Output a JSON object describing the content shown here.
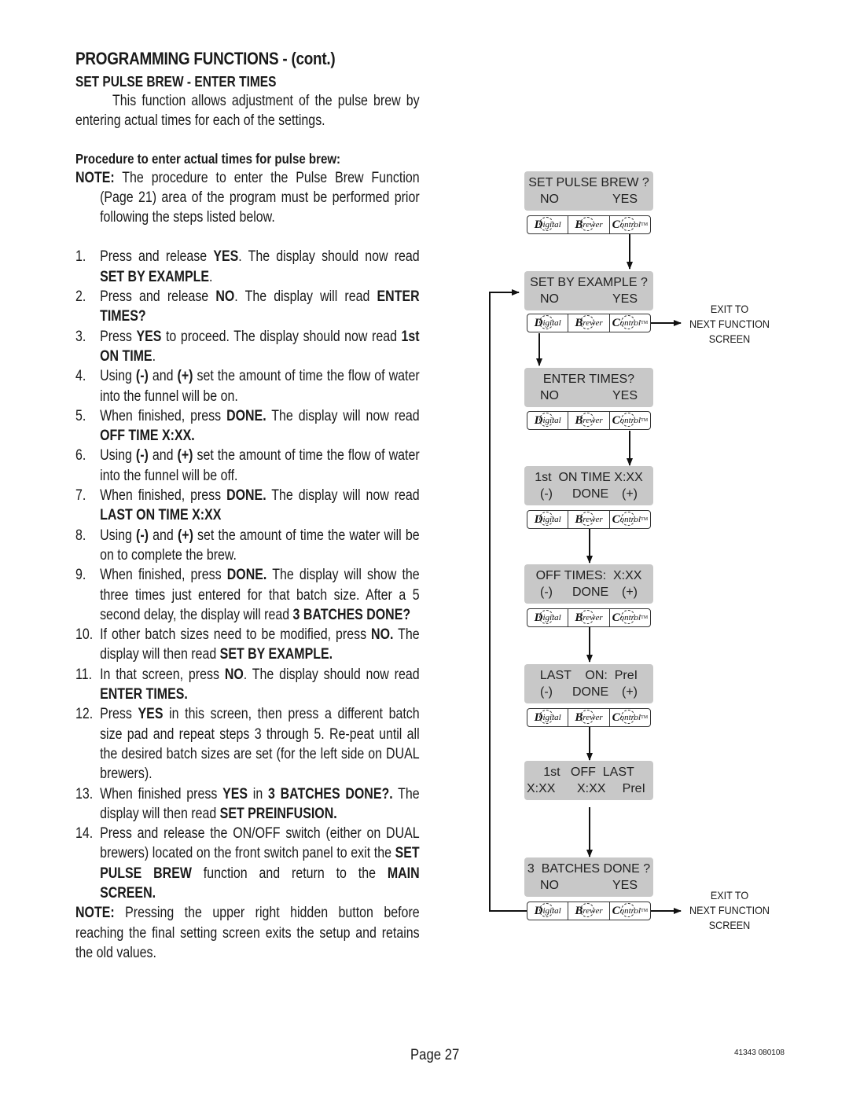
{
  "page": {
    "title": "PROGRAMMING FUNCTIONS - (cont.)",
    "section_title": "SET PULSE BREW - ENTER TIMES",
    "intro": "This function allows adjustment of the pulse brew by entering actual times for each of the settings.",
    "procedure_title": "Procedure to enter actual times for pulse brew:",
    "note1_label": "NOTE:",
    "note1_text": " The procedure to enter the Pulse Brew Function (Page 21) area of the program must be performed prior following the steps listed below.",
    "steps": [
      {
        "num": "1.",
        "parts": [
          [
            "t",
            "Press and release "
          ],
          [
            "b",
            "YES"
          ],
          [
            "t",
            ". The display should now read "
          ],
          [
            "b",
            "SET BY EXAMPLE"
          ],
          [
            "t",
            "."
          ]
        ]
      },
      {
        "num": "2.",
        "parts": [
          [
            "t",
            "Press and release "
          ],
          [
            "b",
            "NO"
          ],
          [
            "t",
            ". The display will read "
          ],
          [
            "b",
            "ENTER TIMES?"
          ]
        ]
      },
      {
        "num": "3.",
        "parts": [
          [
            "t",
            "Press "
          ],
          [
            "b",
            "YES"
          ],
          [
            "t",
            " to proceed. The display should now read "
          ],
          [
            "b",
            "1st ON TIME"
          ],
          [
            "t",
            "."
          ]
        ]
      },
      {
        "num": "4.",
        "parts": [
          [
            "t",
            "Using "
          ],
          [
            "b",
            "(-)"
          ],
          [
            "t",
            " and "
          ],
          [
            "b",
            "(+)"
          ],
          [
            "t",
            " set the amount of time the flow of water into the funnel will be on."
          ]
        ]
      },
      {
        "num": "5.",
        "parts": [
          [
            "t",
            "When finished, press "
          ],
          [
            "b",
            "DONE."
          ],
          [
            "t",
            " The display will now read "
          ],
          [
            "b",
            "OFF TIME X:XX."
          ]
        ]
      },
      {
        "num": "6.",
        "parts": [
          [
            "t",
            "Using "
          ],
          [
            "b",
            "(-)"
          ],
          [
            "t",
            " and "
          ],
          [
            "b",
            "(+)"
          ],
          [
            "t",
            " set the amount of time the flow of water into the funnel will be off."
          ]
        ]
      },
      {
        "num": "7.",
        "parts": [
          [
            "t",
            "When finished, press "
          ],
          [
            "b",
            "DONE."
          ],
          [
            "t",
            " The display will now read "
          ],
          [
            "b",
            "LAST ON TIME X:XX"
          ]
        ]
      },
      {
        "num": "8.",
        "parts": [
          [
            "t",
            "Using "
          ],
          [
            "b",
            "(-)"
          ],
          [
            "t",
            " and "
          ],
          [
            "b",
            "(+)"
          ],
          [
            "t",
            " set the amount of time the water will be on to complete the brew."
          ]
        ]
      },
      {
        "num": "9.",
        "parts": [
          [
            "t",
            "When finished, press "
          ],
          [
            "b",
            "DONE."
          ],
          [
            "t",
            " The display will show the three times just entered for that batch size. After a 5 second delay, the display will read "
          ],
          [
            "b",
            "3 BATCHES DONE?"
          ]
        ]
      },
      {
        "num": "10.",
        "parts": [
          [
            "t",
            "If other batch sizes need to be modified, press "
          ],
          [
            "b",
            "NO."
          ],
          [
            "t",
            " The display will then read "
          ],
          [
            "b",
            "SET BY EXAMPLE."
          ]
        ]
      },
      {
        "num": "11.",
        "parts": [
          [
            "t",
            "In that screen, press "
          ],
          [
            "b",
            "NO"
          ],
          [
            "t",
            ". The display should now read "
          ],
          [
            "b",
            "ENTER TIMES."
          ]
        ]
      },
      {
        "num": "12.",
        "parts": [
          [
            "t",
            "Press "
          ],
          [
            "b",
            "YES"
          ],
          [
            "t",
            " in this screen, then press a different batch size pad and repeat steps 3 through 5.  Re-peat until all the desired batch sizes are set (for the left side on DUAL brewers)."
          ]
        ]
      },
      {
        "num": "13.",
        "parts": [
          [
            "t",
            "When finished press "
          ],
          [
            "b",
            "YES"
          ],
          [
            "t",
            " in "
          ],
          [
            "b",
            "3 BATCHES DONE?."
          ],
          [
            "t",
            " The display will then read "
          ],
          [
            "b",
            "SET PREINFUSION."
          ]
        ]
      },
      {
        "num": "14.",
        "parts": [
          [
            "t",
            "Press and release the ON/OFF switch (either on DUAL brewers) located on the front switch panel to exit the "
          ],
          [
            "b",
            "SET PULSE BREW"
          ],
          [
            "t",
            " function and return to the "
          ],
          [
            "b",
            "MAIN SCREEN."
          ]
        ]
      }
    ],
    "note2_label": "NOTE:",
    "note2_text": " Pressing the upper right hidden button before reaching the final setting screen exits the setup and retains the old values.",
    "footer": {
      "page_label": "Page 27",
      "doc_code": "41343 080108"
    }
  },
  "diagram": {
    "panel_buttons": [
      {
        "initial": "D",
        "rest": "igital"
      },
      {
        "initial": "B",
        "rest": "rewer"
      },
      {
        "initial": "C",
        "rest": "ontrol",
        "tm": "TM"
      }
    ],
    "screens": [
      {
        "id": "set-pulse-brew",
        "line1": [
          {
            "text": "SET PULSE BREW ?",
            "align": "center"
          }
        ],
        "line2": [
          {
            "text": "NO",
            "pos": "left"
          },
          {
            "text": "YES",
            "pos": "right"
          }
        ],
        "has_panel": true
      },
      {
        "id": "set-by-example",
        "line1": [
          {
            "text": "SET BY EXAMPLE ?",
            "align": "center"
          }
        ],
        "line2": [
          {
            "text": "NO",
            "pos": "left"
          },
          {
            "text": "YES",
            "pos": "right"
          }
        ],
        "has_panel": true
      },
      {
        "id": "enter-times",
        "line1": [
          {
            "text": "ENTER TIMES?",
            "align": "center"
          }
        ],
        "line2": [
          {
            "text": "NO",
            "pos": "left"
          },
          {
            "text": "YES",
            "pos": "right"
          }
        ],
        "has_panel": true
      },
      {
        "id": "first-on-time",
        "line1": [
          {
            "text": "1st  ON TIME X:XX",
            "align": "center"
          }
        ],
        "line2": [
          {
            "text": "(-)",
            "pos": "left"
          },
          {
            "text": "DONE",
            "pos": "mid"
          },
          {
            "text": "(+)",
            "pos": "right"
          }
        ],
        "has_panel": true
      },
      {
        "id": "off-times",
        "line1": [
          {
            "text": "OFF TIMES:  X:XX",
            "align": "center"
          }
        ],
        "line2": [
          {
            "text": "(-)",
            "pos": "left"
          },
          {
            "text": "DONE",
            "pos": "mid"
          },
          {
            "text": "(+)",
            "pos": "right"
          }
        ],
        "has_panel": true
      },
      {
        "id": "last-on",
        "line1": [
          {
            "text": "LAST    ON:  PreI",
            "align": "center"
          }
        ],
        "line2": [
          {
            "text": "(-)",
            "pos": "left"
          },
          {
            "text": "DONE",
            "pos": "mid"
          },
          {
            "text": "(+)",
            "pos": "right"
          }
        ],
        "has_panel": true
      },
      {
        "id": "summary",
        "line1": [
          {
            "text": "1st   OFF  LAST",
            "align": "center"
          }
        ],
        "line2": [
          {
            "text": "X:XX",
            "pos": "left"
          },
          {
            "text": "X:XX",
            "pos": "mid"
          },
          {
            "text": "PreI",
            "pos": "right"
          }
        ],
        "has_panel": false
      },
      {
        "id": "batches-done",
        "line1": [
          {
            "text": "3  BATCHES DONE ?",
            "align": "center"
          }
        ],
        "line2": [
          {
            "text": "NO",
            "pos": "left"
          },
          {
            "text": "YES",
            "pos": "right"
          }
        ],
        "has_panel": true
      }
    ],
    "exit_labels": [
      {
        "line1": "EXIT TO",
        "line2": "NEXT FUNCTION",
        "line3": "SCREEN"
      },
      {
        "line1": "EXIT TO",
        "line2": "NEXT FUNCTION",
        "line3": "SCREEN"
      }
    ]
  }
}
